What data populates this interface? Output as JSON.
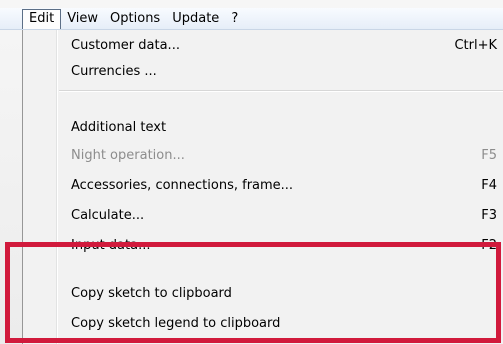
{
  "menubar": {
    "items": [
      {
        "label": "Edit",
        "active": true
      },
      {
        "label": "View"
      },
      {
        "label": "Options"
      },
      {
        "label": "Update"
      },
      {
        "label": "?"
      }
    ]
  },
  "edit_menu": {
    "items": [
      {
        "label": "Customer data...",
        "shortcut": "Ctrl+K",
        "enabled": true
      },
      {
        "label": "Currencies ...",
        "shortcut": "",
        "enabled": true
      },
      {
        "label": "Additional text",
        "shortcut": "",
        "enabled": true
      },
      {
        "label": "Night operation...",
        "shortcut": "F5",
        "enabled": false
      },
      {
        "label": "Accessories, connections, frame...",
        "shortcut": "F4",
        "enabled": true
      },
      {
        "label": "Calculate...",
        "shortcut": "F3",
        "enabled": true
      },
      {
        "label": "Input data...",
        "shortcut": "F2",
        "enabled": true
      },
      {
        "label": "Copy sketch to clipboard",
        "shortcut": "",
        "enabled": true
      },
      {
        "label": "Copy sketch legend to clipboard",
        "shortcut": "",
        "enabled": true
      }
    ]
  },
  "colors": {
    "highlight_border": "#d11a3c",
    "disabled_text": "#8d8d8d"
  }
}
